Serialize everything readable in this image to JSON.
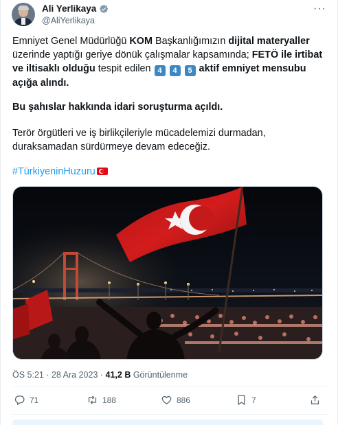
{
  "author": {
    "name": "Ali Yerlikaya",
    "handle": "@AliYerlikaya"
  },
  "tweet": {
    "p1_a": "Emniyet Genel Müdürlüğü ",
    "p1_b": "KOM",
    "p1_c": " Başkanlığımızın ",
    "p1_d": "dijital materyaller",
    "p1_e": " üzerinde yaptığı geriye dönük çalışmalar kapsamında; ",
    "p1_f": "FETÖ ile irtibat ve iltisaklı olduğu",
    "p1_g": " tespit edilen ",
    "digit_1": "4",
    "digit_2": "4",
    "digit_3": "5",
    "p1_h": " aktif emniyet mensubu açığa alındı.",
    "p2": "Bu şahıslar hakkında idari soruşturma açıldı.",
    "p3": "Terör örgütleri ve iş birlikçileriyle mücadelemizi durmadan, duraksamadan sürdürmeye devam edeceğiz.",
    "hashtag": "#TürkiyeninHuzuru"
  },
  "meta": {
    "time": "ÖS 5:21",
    "dot1": " · ",
    "date": "28 Ara 2023",
    "dot2": " · ",
    "views": "41,2 B",
    "views_label": " Görüntülenme"
  },
  "actions": {
    "replies": "71",
    "reposts": "188",
    "likes": "886",
    "bookmarks": "7"
  },
  "colors": {
    "accent": "#1d9bf0",
    "text": "#0f1419",
    "muted": "#536471",
    "flag_red": "#e30a17"
  },
  "icons": [
    "verified-badge-icon",
    "more-icon",
    "reply-icon",
    "repost-icon",
    "like-icon",
    "bookmark-icon",
    "share-icon",
    "turkey-flag-emoji"
  ]
}
